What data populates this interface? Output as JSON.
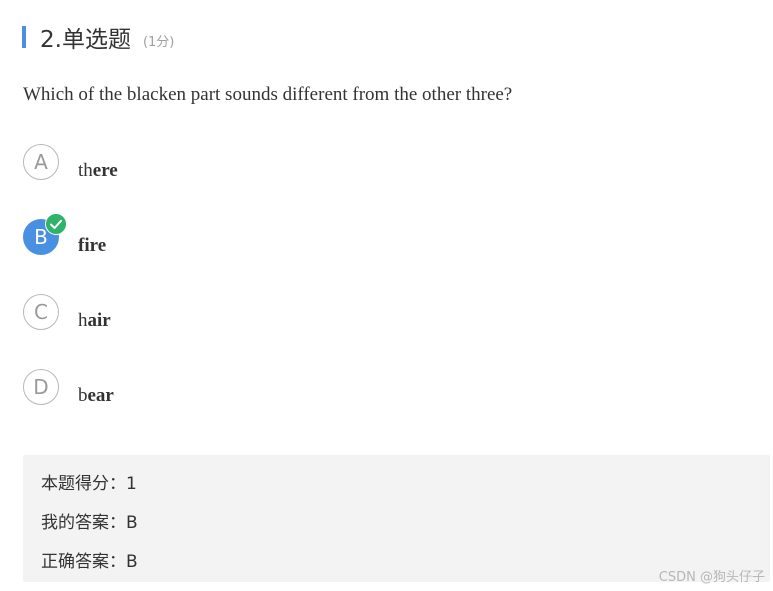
{
  "question": {
    "title": "2.单选题",
    "score": "(1分)",
    "text": "Which of the blacken part sounds different from the other three?",
    "accent_color": "#4a90e2"
  },
  "options": [
    {
      "letter": "A",
      "word_plain": "th",
      "word_bold": "ere",
      "selected": false
    },
    {
      "letter": "B",
      "word_plain": "",
      "word_bold": "fire",
      "selected": true,
      "badge_icon": "check-icon",
      "badge_color": "#2fb36b"
    },
    {
      "letter": "C",
      "word_plain": "h",
      "word_bold": "air",
      "selected": false
    },
    {
      "letter": "D",
      "word_plain": "b",
      "word_bold": "ear",
      "selected": false
    }
  ],
  "result": {
    "score_line": "本题得分：1",
    "my_answer_line": "我的答案：B",
    "correct_answer_line": "正确答案：B"
  },
  "watermark": "CSDN @狗头仔子"
}
